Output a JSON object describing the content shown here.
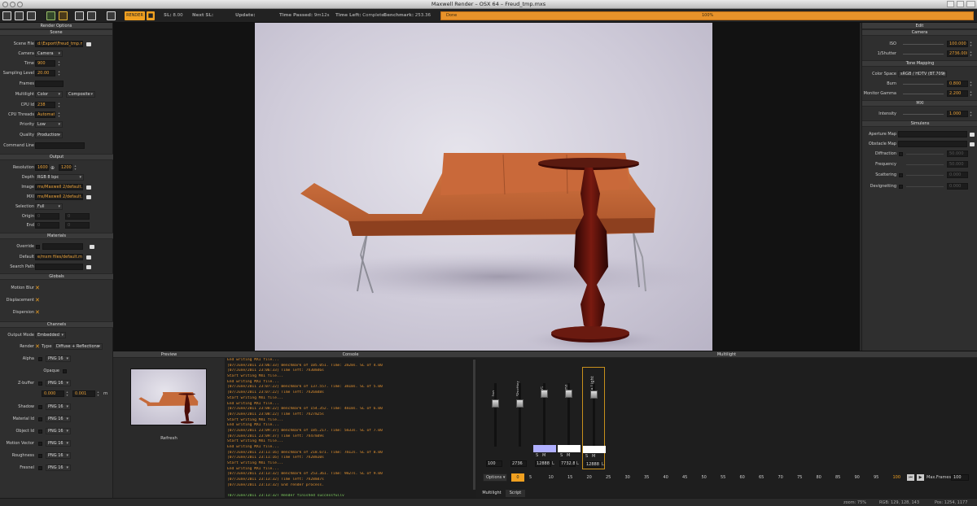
{
  "window": {
    "title": "Maxwell Render  –  OSX 64 – Freud_tmp.mxs"
  },
  "toolbar": {
    "render_label": "RENDER",
    "sl_label": "SL:",
    "sl_value": "8.00",
    "next_sl_label": "Next SL:",
    "update_label": "Update:",
    "time_passed_label": "Time Passed:",
    "time_passed_value": "9m12s",
    "time_left_label": "Time Left:",
    "time_left_value": "Complete",
    "benchmark_label": "Benchmark:",
    "benchmark_value": "253.36",
    "progress_label": "Done",
    "progress_value": "100%",
    "progress_fraction": 1.0,
    "accent": "#f0a020"
  },
  "render_options": {
    "title": "Render Options",
    "scene_section": "Scene",
    "scene_file_label": "Scene File",
    "scene_file": "d:\\Export\\Freud_tmp.mxs",
    "camera_label": "Camera",
    "camera": "Camera",
    "time_label": "Time",
    "time": "900",
    "sampling_label": "Sampling Level",
    "sampling": "20.00",
    "frames_label": "Frames",
    "frames": "",
    "multilight_label": "Multilight",
    "multilight": "Color",
    "multilight_mode": "Composite",
    "cpu_id_label": "CPU Id",
    "cpu_id": "238",
    "cpu_threads_label": "CPU Threads",
    "cpu_threads": "Automatic",
    "priority_label": "Priority",
    "priority": "Low",
    "quality_label": "Quality",
    "quality": "Production",
    "command_line_label": "Command Line",
    "command_line": "",
    "output_section": "Output",
    "resolution_label": "Resolution",
    "res_w": "1600",
    "res_h": "1200",
    "depth_label": "Depth",
    "depth": "RGB 8 bpc",
    "image_label": "Image",
    "image": "ms/Maxwell 2/default.png",
    "mxi_label": "MXI",
    "mxi": "ms/Maxwell 2/default.mxi",
    "selection_label": "Selection",
    "selection": "Full",
    "origin_label": "Origin",
    "origin_x": "0",
    "origin_y": "0",
    "end_label": "End",
    "end_x": "0",
    "end_y": "0",
    "materials_section": "Materials",
    "override_label": "Override",
    "override": "",
    "default_label": "Default",
    "default": "e/mxm files/default.mxm",
    "search_path_label": "Search Path",
    "search_path": "",
    "globals_section": "Globals",
    "motion_blur_label": "Motion Blur",
    "displacement_label": "Displacement",
    "dispersion_label": "Dispersion",
    "channels_section": "Channels",
    "output_mode_label": "Output Mode",
    "output_mode": "Embedded",
    "render_label": "Render",
    "type_label": "Type",
    "render_type": "Diffuse + Reflections",
    "alpha_label": "Alpha",
    "alpha": "PNG 16",
    "opaque_label": "Opaque",
    "zbuffer_label": "Z-buffer",
    "zbuffer": "PNG 16",
    "z_min": "0.000",
    "z_max": "0.001",
    "z_unit": "m",
    "shadow_label": "Shadow",
    "shadow": "PNG 16",
    "material_id_label": "Material Id",
    "material_id": "PNG 16",
    "object_id_label": "Object Id",
    "object_id": "PNG 16",
    "motion_vector_label": "Motion Vector",
    "motion_vector": "PNG 16",
    "roughness_label": "Roughness",
    "roughness": "PNG 16",
    "fresnel_label": "Fresnel",
    "fresnel": "PNG 16"
  },
  "edit": {
    "title": "Edit",
    "camera_section": "Camera",
    "iso_label": "ISO",
    "iso": "100.000",
    "shutter_label": "1/Shutter",
    "shutter": "2736.000",
    "tone_section": "Tone Mapping",
    "color_space_label": "Color Space",
    "color_space": "sRGB / HDTV (BT.709)",
    "burn_label": "Burn",
    "burn": "0.800",
    "gamma_label": "Monitor Gamma",
    "gamma": "2.200",
    "mxi_section": "MXI",
    "intensity_label": "Intensity",
    "intensity": "1.000",
    "simulens_section": "Simulens",
    "aperture_label": "Aperture Map",
    "obstacle_label": "Obstacle Map",
    "diffraction_label": "Diffraction",
    "diffraction": "50.000",
    "frequency_label": "Frequency",
    "frequency": "50.000",
    "scattering_label": "Scattering",
    "scattering": "0.000",
    "devignetting_label": "Devignetting",
    "devignetting": "0.000"
  },
  "preview": {
    "title": "Preview",
    "refresh_label": "Refresh"
  },
  "console": {
    "title": "Console",
    "lines": [
      "End writing MXI file...",
      "[07/June/2011 23:06:33] Benchmark of 105.051. Time: 2m28s. SL of 4.00",
      "[07/June/2011 23:06:33] Time left: 7h30m46s",
      "Start writing MXI file...",
      "End writing MXI file...",
      "[07/June/2011 23:07:22] Benchmark of 137.557. Time: 3m18s. SL of 5.00",
      "[07/June/2011 23:07:22] Time left: 7h26m48s",
      "Start writing MXI file...",
      "End writing MXI file...",
      "[07/June/2011 23:08:22] Benchmark of 154.352. Time: 4m18s. SL of 6.00",
      "[07/June/2011 23:08:22] Time left: 7h27m25s",
      "Start writing MXI file...",
      "End writing MXI file...",
      "[07/June/2011 23:09:37] Benchmark of 185.217. Time: 5m33s. SL of 7.00",
      "[07/June/2011 23:09:37] Time left: 7h47m49s",
      "Start writing MXI file...",
      "End writing MXI file...",
      "[07/June/2011 23:11:16] Benchmark of 218.671. Time: 7m12s. SL of 8.00",
      "[07/June/2011 23:11:16] Time left: 7h28m10s",
      "Start writing MXI file...",
      "End writing MXI file...",
      "[07/June/2011 23:13:32] Benchmark of 253.361. Time: 9m27s. SL of 9.00",
      "[07/June/2011 23:13:32] Time left: 7h28m47s",
      "[07/June/2011 23:13:32] End render process.",
      "",
      "[07/June/2011 23:13:32] Render finished successfully"
    ]
  },
  "multilight": {
    "title": "Multilight",
    "channels": [
      {
        "name": "Iso",
        "value": "100"
      },
      {
        "name": "Shutter",
        "value": "2736"
      },
      {
        "name": "IBKG",
        "value": "12888"
      },
      {
        "name": "IBKD1",
        "value": "7732.8"
      },
      {
        "name": "Area Light",
        "value": "12888"
      }
    ],
    "s_label": "S",
    "m_label": "M",
    "l_label": "L",
    "options_label": "Options",
    "frame_value": "0",
    "scale": [
      "5",
      "10",
      "15",
      "20",
      "25",
      "30",
      "35",
      "40",
      "45",
      "50",
      "55",
      "60",
      "65",
      "70",
      "75",
      "80",
      "85",
      "90",
      "95",
      "100"
    ],
    "max_frames_label": "Max.Frames",
    "max_frames": "100",
    "tabs": [
      "Multilight",
      "Script"
    ]
  },
  "status": {
    "zoom": "zoom: 75%",
    "rgb": "RGB: 129, 128, 143",
    "pos": "Pos: 1254, 1177"
  }
}
